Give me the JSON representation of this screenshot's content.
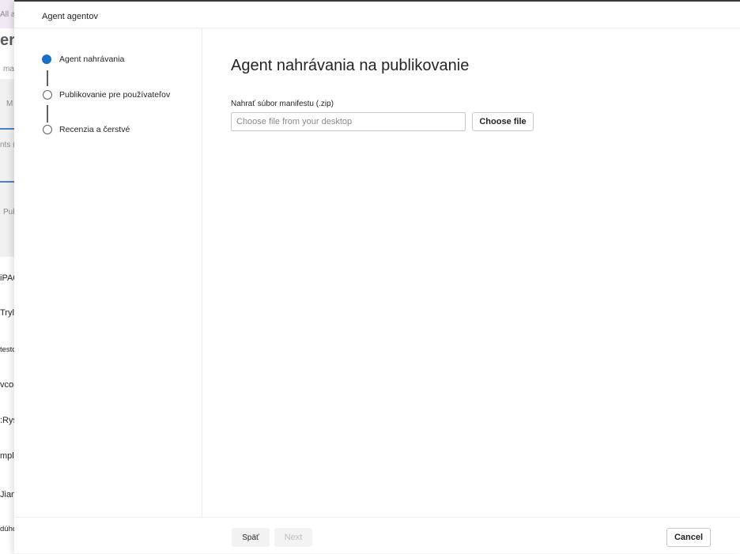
{
  "background": {
    "items": [
      {
        "text": "All a",
        "style": "muted"
      },
      {
        "text": "er",
        "style": "big"
      },
      {
        "text": "ma",
        "style": "muted"
      },
      {
        "text": "M",
        "style": "muted"
      },
      {
        "text": "nts (",
        "style": "muted"
      },
      {
        "text": "Pub",
        "style": "muted"
      },
      {
        "text": "iPAQ",
        "style": "normal"
      },
      {
        "text": "Trylová",
        "style": "normal"
      },
      {
        "text": "testovacia",
        "style": "normal"
      },
      {
        "text": "vcor",
        "style": "normal"
      },
      {
        "text": ":Rys",
        "style": "normal"
      },
      {
        "text": "mpla",
        "style": "normal"
      },
      {
        "text": "Jian",
        "style": "normal"
      },
      {
        "text": "dúhovka",
        "style": "normal"
      }
    ]
  },
  "panel": {
    "title": "Agent agentov"
  },
  "steps": [
    {
      "label": "Agent nahrávania",
      "state": "active"
    },
    {
      "label": "Publikovanie pre používateľov",
      "state": "pending"
    },
    {
      "label": "Recenzia a čerstvé",
      "state": "pending"
    }
  ],
  "content": {
    "title": "Agent nahrávania na publikovanie",
    "field_label": "Nahrať súbor manifestu (.zip)",
    "file_input_placeholder": "Choose file from your desktop",
    "choose_button": "Choose file"
  },
  "footer": {
    "back": "Späť",
    "next": "Next",
    "cancel": "Cancel"
  },
  "colors": {
    "accent": "#1a6fc6"
  }
}
